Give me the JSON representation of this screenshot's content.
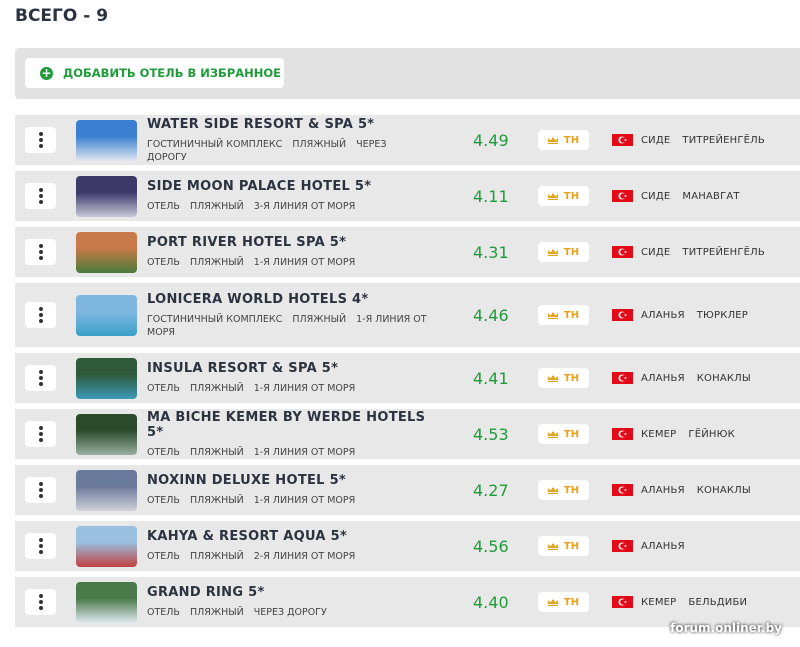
{
  "header": {
    "total": "ВСЕГО - 9"
  },
  "toolbar": {
    "add_label": "ДОБАВИТЬ ОТЕЛЬ В ИЗБРАННОЕ"
  },
  "hotels": [
    {
      "name": "WATER SIDE RESORT & SPA 5*",
      "tags": [
        "ГОСТИНИЧНЫЙ КОМПЛЕКС",
        "ПЛЯЖНЫЙ",
        "ЧЕРЕЗ ДОРОГУ"
      ],
      "rating": "4.49",
      "badge": "TH",
      "city": "СИДЕ",
      "area": "ТИТРЕЙЕНГЁЛЬ",
      "tall": false,
      "img": [
        "#3b7fd0",
        "#dfe6ef"
      ]
    },
    {
      "name": "SIDE MOON PALACE HOTEL 5*",
      "tags": [
        "ОТЕЛЬ",
        "ПЛЯЖНЫЙ",
        "3-Я ЛИНИЯ ОТ МОРЯ"
      ],
      "rating": "4.11",
      "badge": "TH",
      "city": "СИДЕ",
      "area": "МАНАВГАТ",
      "tall": false,
      "img": [
        "#3d3a6a",
        "#c8c8d8"
      ]
    },
    {
      "name": "PORT RIVER HOTEL SPA 5*",
      "tags": [
        "ОТЕЛЬ",
        "ПЛЯЖНЫЙ",
        "1-Я ЛИНИЯ ОТ МОРЯ"
      ],
      "rating": "4.31",
      "badge": "TH",
      "city": "СИДЕ",
      "area": "ТИТРЕЙЕНГЁЛЬ",
      "tall": false,
      "img": [
        "#c97a4a",
        "#4a7a3a"
      ]
    },
    {
      "name": "LONICERA WORLD HOTELS 4*",
      "tags": [
        "ГОСТИНИЧНЫЙ КОМПЛЕКС",
        "ПЛЯЖНЫЙ",
        "1-Я ЛИНИЯ ОТ МОРЯ"
      ],
      "rating": "4.46",
      "badge": "TH",
      "city": "АЛАНЬЯ",
      "area": "ТЮРКЛЕР",
      "tall": true,
      "img": [
        "#7fb6e0",
        "#3aa0c8"
      ]
    },
    {
      "name": "INSULA RESORT & SPA 5*",
      "tags": [
        "ОТЕЛЬ",
        "ПЛЯЖНЫЙ",
        "1-Я ЛИНИЯ ОТ МОРЯ"
      ],
      "rating": "4.41",
      "badge": "TH",
      "city": "АЛАНЬЯ",
      "area": "КОНАКЛЫ",
      "tall": false,
      "img": [
        "#2e5a3a",
        "#3c9ab8"
      ]
    },
    {
      "name": "MA BICHE KEMER BY WERDE HOTELS 5*",
      "tags": [
        "ОТЕЛЬ",
        "ПЛЯЖНЫЙ",
        "1-Я ЛИНИЯ ОТ МОРЯ"
      ],
      "rating": "4.53",
      "badge": "TH",
      "city": "КЕМЕР",
      "area": "ГЁЙНЮК",
      "tall": false,
      "img": [
        "#2a4a2a",
        "#9ab0a0"
      ]
    },
    {
      "name": "NOXINN DELUXE HOTEL 5*",
      "tags": [
        "ОТЕЛЬ",
        "ПЛЯЖНЫЙ",
        "1-Я ЛИНИЯ ОТ МОРЯ"
      ],
      "rating": "4.27",
      "badge": "TH",
      "city": "АЛАНЬЯ",
      "area": "КОНАКЛЫ",
      "tall": false,
      "img": [
        "#6a7a9a",
        "#d0d0d8"
      ]
    },
    {
      "name": "KAHYA & RESORT AQUA 5*",
      "tags": [
        "ОТЕЛЬ",
        "ПЛЯЖНЫЙ",
        "2-Я ЛИНИЯ ОТ МОРЯ"
      ],
      "rating": "4.56",
      "badge": "TH",
      "city": "АЛАНЬЯ",
      "area": "",
      "tall": false,
      "img": [
        "#9ac0e0",
        "#c04040"
      ]
    },
    {
      "name": "GRAND RING 5*",
      "tags": [
        "ОТЕЛЬ",
        "ПЛЯЖНЫЙ",
        "ЧЕРЕЗ ДОРОГУ"
      ],
      "rating": "4.40",
      "badge": "TH",
      "city": "КЕМЕР",
      "area": "БЕЛЬДИБИ",
      "tall": false,
      "img": [
        "#4a7a4a",
        "#e0e8f0"
      ]
    }
  ],
  "watermark": "forum.onliner.by"
}
